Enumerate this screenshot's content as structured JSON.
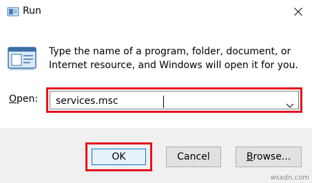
{
  "window": {
    "title": "Run",
    "close_glyph": "✕",
    "icon": "run-icon"
  },
  "dialog": {
    "description": "Type the name of a program, folder, document, or Internet resource, and Windows will open it for you.",
    "open_label_mnemonic": "O",
    "open_label_rest": "pen:",
    "input_value": "services.msc",
    "highlight_color": "#e2121d"
  },
  "buttons": {
    "ok": "OK",
    "cancel": "Cancel",
    "browse_mnemonic": "B",
    "browse_rest": "rowse..."
  },
  "watermark": "wsxdn.com"
}
